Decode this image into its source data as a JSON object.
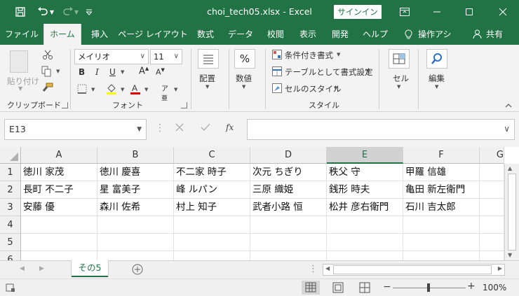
{
  "titlebar": {
    "title": "choi_tech05.xlsx  -  Excel",
    "signin_label": "サインイン",
    "bg_color": "#217346"
  },
  "tabs": [
    {
      "id": "file",
      "label": "ファイル"
    },
    {
      "id": "home",
      "label": "ホーム",
      "active": true
    },
    {
      "id": "insert",
      "label": "挿入"
    },
    {
      "id": "layout",
      "label": "ページ レイアウト"
    },
    {
      "id": "formulas",
      "label": "数式"
    },
    {
      "id": "data",
      "label": "データ"
    },
    {
      "id": "review",
      "label": "校閲"
    },
    {
      "id": "view",
      "label": "表示"
    },
    {
      "id": "developer",
      "label": "開発"
    },
    {
      "id": "help",
      "label": "ヘルプ"
    },
    {
      "id": "tellme",
      "label": "操作アシ"
    },
    {
      "id": "share",
      "label": "共有"
    }
  ],
  "ribbon": {
    "clipboard": {
      "paste_label": "貼り付け",
      "group_label": "クリップボード"
    },
    "font": {
      "font_name": "メイリオ",
      "font_size": "11",
      "group_label": "フォント",
      "bold": "B",
      "italic": "I",
      "underline": "U"
    },
    "alignment": {
      "label": "配置"
    },
    "number": {
      "label": "数値",
      "symbol": "%"
    },
    "styles": {
      "conditional": "条件付き書式",
      "as_table": "テーブルとして書式設定",
      "cell_style": "セルのスタイル",
      "group_label": "スタイル"
    },
    "cells": {
      "label": "セル"
    },
    "editing": {
      "label": "編集"
    }
  },
  "formula_bar": {
    "name_box": "E13",
    "fx": "fx",
    "formula": ""
  },
  "columns": [
    "A",
    "B",
    "C",
    "D",
    "E",
    "F",
    "G"
  ],
  "selected_column": "E",
  "rows": [
    "1",
    "2",
    "3",
    "4",
    "5",
    "6"
  ],
  "cells": [
    [
      "徳川 家茂",
      "徳川 慶喜",
      "不二家 時子",
      "次元 ちぎり",
      "秩父 守",
      "甲羅 信雄"
    ],
    [
      "長町 不二子",
      "星 富美子",
      "峰 ルパン",
      "三原 織姫",
      "銭形 時夫",
      "亀田 新左衛門"
    ],
    [
      "安藤 優",
      "森川 佐希",
      "村上 知子",
      "武者小路 恒",
      "松井 彦右衛門",
      "石川 吉太郎"
    ],
    [
      "",
      "",
      "",
      "",
      "",
      ""
    ],
    [
      "",
      "",
      "",
      "",
      "",
      ""
    ],
    [
      "",
      "",
      "",
      "",
      "",
      ""
    ]
  ],
  "sheets": [
    {
      "name": "その5",
      "active": true
    }
  ],
  "statusbar": {
    "zoom": "100%"
  }
}
